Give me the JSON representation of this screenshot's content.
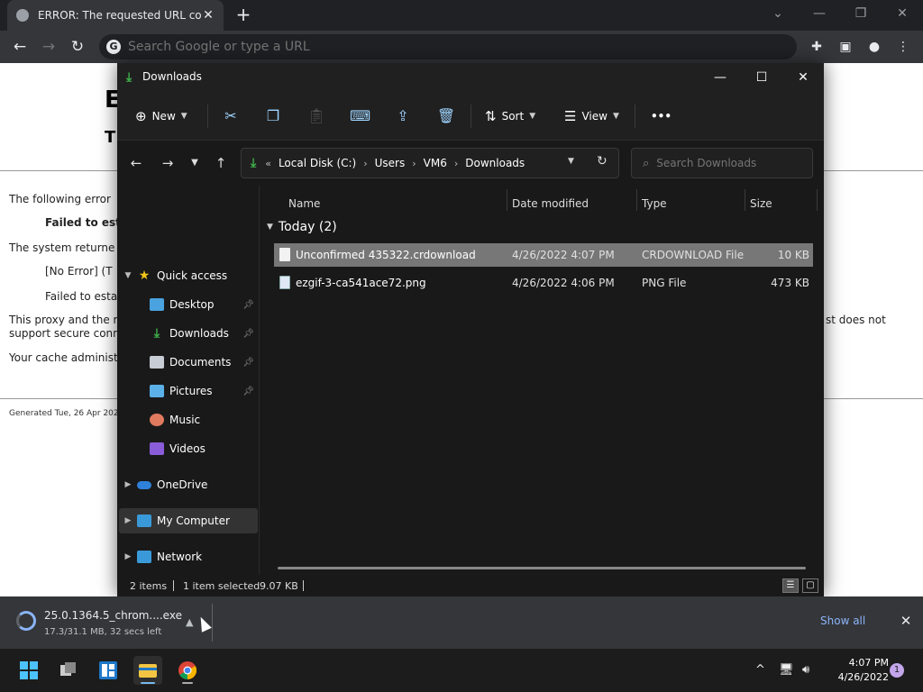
{
  "browser": {
    "tab_title": "ERROR: The requested URL could not be retrieved",
    "tab_close": "✕",
    "new_tab": "+",
    "omnibox_placeholder": "Search Google or type a URL",
    "nav": {
      "back": "←",
      "forward": "→",
      "reload": "↻"
    },
    "window_controls": {
      "minimize": "—",
      "restore": "❐",
      "close": "✕",
      "search_tabs": "⌄"
    }
  },
  "error_page": {
    "h1": "E",
    "h2": "T",
    "line1": "The following error",
    "line2": "Failed to est",
    "line3": "The system returne",
    "line4": "[No Error] (T",
    "line5": "Failed to esta",
    "line6a": "This proxy and the r",
    "line6b": "support secure conn",
    "line6c": "st does not",
    "line7": "Your cache administ",
    "footer": "Generated Tue, 26 Apr 202"
  },
  "explorer": {
    "title": "Downloads",
    "window_controls": {
      "minimize": "—",
      "maximize": "☐",
      "close": "✕"
    },
    "commands": {
      "new": "New",
      "sort": "Sort",
      "view": "View",
      "more": "•••"
    },
    "address": {
      "crumbs": [
        "Local Disk (C:)",
        "Users",
        "VM6",
        "Downloads"
      ],
      "separator": "›",
      "overflow": "«"
    },
    "search_placeholder": "Search Downloads",
    "nav_pane": {
      "quick_access": "Quick access",
      "pinned": [
        "Desktop",
        "Downloads",
        "Documents",
        "Pictures"
      ],
      "others": [
        "Music",
        "Videos"
      ],
      "onedrive": "OneDrive",
      "my_computer": "My Computer",
      "network": "Network"
    },
    "columns": {
      "name": "Name",
      "date": "Date modified",
      "type": "Type",
      "size": "Size"
    },
    "group": "Today (2)",
    "files": [
      {
        "name": "Unconfirmed 435322.crdownload",
        "date": "4/26/2022 4:07 PM",
        "type": "CRDOWNLOAD File",
        "size": "10 KB",
        "selected": true
      },
      {
        "name": "ezgif-3-ca541ace72.png",
        "date": "4/26/2022 4:06 PM",
        "type": "PNG File",
        "size": "473 KB",
        "selected": false
      }
    ],
    "status": {
      "items": "2 items",
      "selected": "1 item selected",
      "size": "9.07 KB"
    }
  },
  "download_shelf": {
    "file_name": "25.0.1364.5_chrom....exe",
    "progress_text": "17.3/31.1 MB, 32 secs left",
    "progress_fraction": 0.556,
    "show_all": "Show all",
    "close": "✕"
  },
  "taskbar": {
    "time": "4:07 PM",
    "date": "4/26/2022",
    "notification_count": "1"
  },
  "colors": {
    "accent": "#76b9ed",
    "selection": "#777777",
    "folder_green": "#3fb24a"
  }
}
